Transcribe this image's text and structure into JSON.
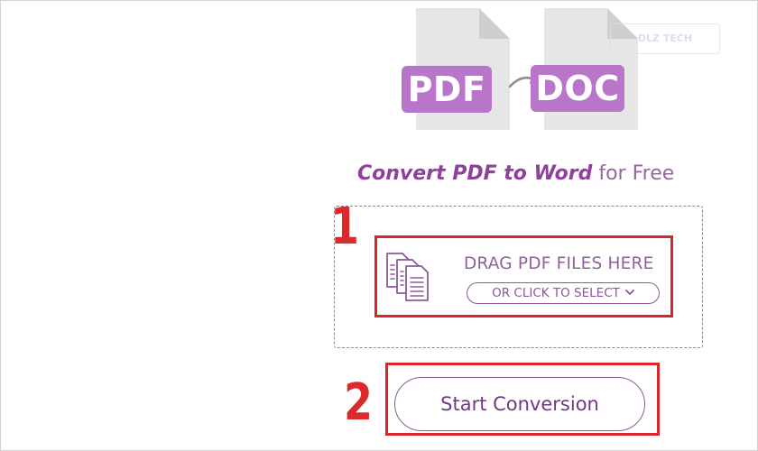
{
  "icons": {
    "source_badge": "PDF",
    "target_badge": "DOC"
  },
  "watermark": {
    "text": "DLZ TECH"
  },
  "headline": {
    "strong": "Convert PDF to Word",
    "rest": " for Free"
  },
  "dropzone": {
    "drag_label": "DRAG PDF FILES HERE",
    "select_label": "OR CLICK TO SELECT"
  },
  "annotations": {
    "step1": "1",
    "step2": "2"
  },
  "actions": {
    "start_label": "Start Conversion"
  },
  "colors": {
    "accent": "#b975c9",
    "text_purple": "#8f3f9c",
    "annotation_red": "#d9252b",
    "file_gray": "#e5e5e5"
  }
}
